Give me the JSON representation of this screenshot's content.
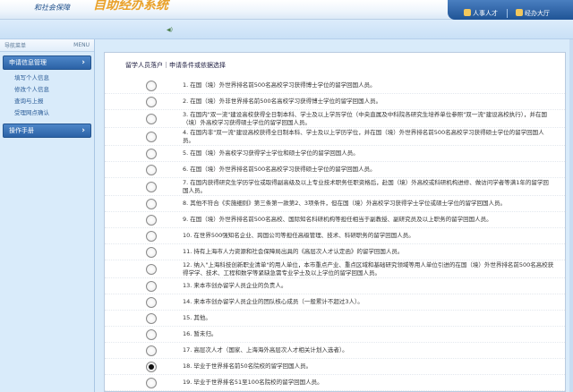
{
  "header": {
    "bureau": "和社会保障",
    "system_title": "自助经办系统",
    "nav": [
      {
        "label": "人事人才",
        "icon": "person-icon"
      },
      {
        "label": "经办大厅",
        "icon": "hall-icon"
      }
    ]
  },
  "sidebar": {
    "title": "导航菜单",
    "menu_label": "MENU",
    "groups": [
      {
        "label": "申请信息管理",
        "items": [
          "填写个人信息",
          "修改个人信息",
          "查询与上报",
          "受理网点确认"
        ]
      },
      {
        "label": "操作手册",
        "items": []
      }
    ]
  },
  "panel": {
    "breadcrumb_section": "留学人员落户",
    "breadcrumb_page": "申请条件或依据选择",
    "selected_index": 17,
    "options": [
      "1. 在国（境）外世界排名前500名高校学习获得博士学位的留学回国人员。",
      "2. 在国（境）外非世界排名前500名高校学习获得博士学位的留学回国人员。",
      "3. 在国内\"双一流\"建设高校获得全日制本科、学士及以上学历学位（中央直属及中科院各研究生培养单位参照\"双一流\"建设高校执行），并在国（境）外高校学习获得硕士学位的留学回国人员。",
      "4. 在国内非\"双一流\"建设高校获得全日制本科、学士及以上学历学位，并在国（境）外世界排名前500名高校学习获得硕士学位的留学回国人员。",
      "5. 在国（境）外高校学习获得学士学位和硕士学位的留学回国人员。",
      "6. 在国（境）外世界排名前500名高校学习获得硕士学位的留学回国人员。",
      "7. 在国内获得研究生学历学位或取得副高级及以上专业技术职务任职资格后，赴国（境）外高校或科研机构进修、做访问学者等满1年的留学回国人员。",
      "8. 其他不符合《实施细则》第三条第一款第2、3项条件，但在国（境）外高校学习获得学士学位或硕士学位的留学回国人员。",
      "9. 在国（境）外世界排名前500名高校、国际知名科研机构等担任相当于副教授、副研究员及以上职务的留学回国人员。",
      "10. 在世界500强知名企业、跨国公司等担任高级管理、技术、科研职务的留学回国人员。",
      "11. 持有上海市人力资源和社会保障局出具的《高层次人才认定函》的留学回国人员。",
      "12. 纳入\"上海科技创新职业清单\"的用人单位，本市重点产业、重点区域和基础研究领域等用人单位引进的在国（境）外世界排名前500名高校获得学学、技术、工程和数学等紧缺急需专业学士及以上学位的留学回国人员。",
      "13. 来本市创办留学人员企业的负责人。",
      "14. 来本市创办留学人员企业的团队核心成员（一般累计不超过3人）。",
      "15. 其他。",
      "16. 暂未归。",
      "17. 高层次人才（国家、上海海外高层次人才相关计划入选者）。",
      "18. 毕业于世界排名前50名院校的留学回国人员。",
      "19. 毕业于世界排名51至100名院校的留学回国人员。"
    ]
  }
}
